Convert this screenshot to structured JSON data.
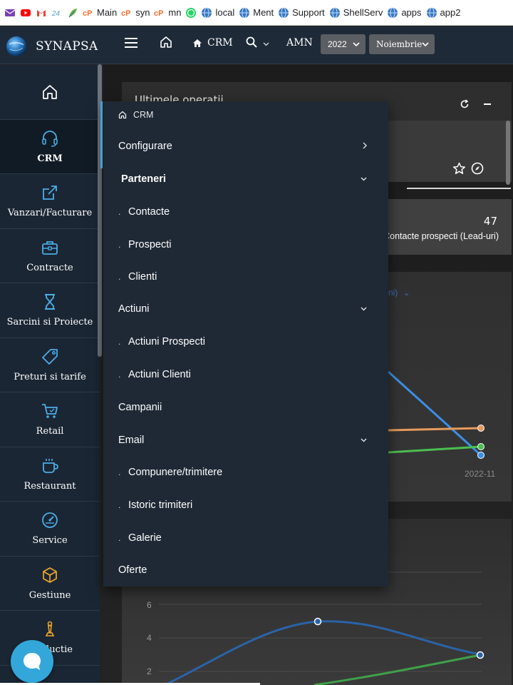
{
  "bookmarks": [
    {
      "label": "",
      "icon": "envelope-icon",
      "color": "#7b3fb3"
    },
    {
      "label": "",
      "icon": "youtube-icon",
      "color": "#ff0000"
    },
    {
      "label": "",
      "icon": "gmail-icon",
      "color": "#ea4335"
    },
    {
      "label": "",
      "icon": "24-icon",
      "color": "#5aa0e0"
    },
    {
      "label": "",
      "icon": "leaf-icon",
      "color": "#7bb84a"
    },
    {
      "label": "Main",
      "icon": "cpanel-icon",
      "color": "#ff6c2c"
    },
    {
      "label": "syn",
      "icon": "cpanel-icon",
      "color": "#ff6c2c"
    },
    {
      "label": "mn",
      "icon": "cpanel-icon",
      "color": "#ff6c2c"
    },
    {
      "label": "",
      "icon": "whatsapp-icon",
      "color": "#25d366"
    },
    {
      "label": "local",
      "icon": "globe-icon",
      "color": "#3b78c2"
    },
    {
      "label": "Ment",
      "icon": "globe-icon",
      "color": "#3b78c2"
    },
    {
      "label": "Support",
      "icon": "globe-icon",
      "color": "#3b78c2"
    },
    {
      "label": "ShellServ",
      "icon": "globe-icon",
      "color": "#3b78c2"
    },
    {
      "label": "apps",
      "icon": "globe-icon",
      "color": "#3b78c2"
    },
    {
      "label": "app2",
      "icon": "globe-icon",
      "color": "#3b78c2"
    }
  ],
  "topbar": {
    "brand": "SYNAPSA",
    "crm_label": "CRM",
    "user_label": "AMN",
    "year_value": "2022",
    "month_value": "Noiembrie"
  },
  "sidebar": {
    "items": [
      {
        "label": "",
        "icon": "home-icon",
        "active": false
      },
      {
        "label": "CRM",
        "icon": "headset-icon",
        "active": true
      },
      {
        "label": "Vanzari/Facturare",
        "icon": "share-icon",
        "active": false
      },
      {
        "label": "Contracte",
        "icon": "briefcase-icon",
        "active": false
      },
      {
        "label": "Sarcini si Proiecte",
        "icon": "hourglass-icon",
        "active": false
      },
      {
        "label": "Preturi si tarife",
        "icon": "tag-icon",
        "active": false
      },
      {
        "label": "Retail",
        "icon": "cart-icon",
        "active": false
      },
      {
        "label": "Restaurant",
        "icon": "coffee-icon",
        "active": false
      },
      {
        "label": "Service",
        "icon": "gauge-icon",
        "active": false
      },
      {
        "label": "Gestiune",
        "icon": "boxes-icon",
        "active": false
      },
      {
        "label": "Productie",
        "icon": "chess-icon",
        "active": false
      }
    ]
  },
  "dashboard": {
    "card1_title": "Ultimele operatii",
    "card2_value": "47",
    "card2_label": "Contacte prospecti (Lead-uri)",
    "card3_filter": "ni)",
    "card3_tick": "2022-11",
    "card4_yticks": [
      "6",
      "4",
      "2"
    ]
  },
  "menu": {
    "header": "CRM",
    "items": [
      {
        "label": "Configurare",
        "level": "top",
        "arrow": "chevron-right-icon"
      },
      {
        "label": "Parteneri",
        "level": "bold",
        "arrow": "chevron-down-icon"
      },
      {
        "label": "Contacte",
        "level": "sub",
        "dot": "."
      },
      {
        "label": "Prospecti",
        "level": "sub",
        "dot": "."
      },
      {
        "label": "Clienti",
        "level": "sub",
        "dot": "."
      },
      {
        "label": "Actiuni",
        "level": "top",
        "arrow": "chevron-down-icon"
      },
      {
        "label": "Actiuni Prospecti",
        "level": "sub",
        "dot": "."
      },
      {
        "label": "Actiuni Clienti",
        "level": "sub",
        "dot": "."
      },
      {
        "label": "Campanii",
        "level": "top"
      },
      {
        "label": "Email",
        "level": "top",
        "arrow": "chevron-down-icon"
      },
      {
        "label": "Compunere/trimitere",
        "level": "sub",
        "dot": "."
      },
      {
        "label": "Istoric trimiteri",
        "level": "sub",
        "dot": "."
      },
      {
        "label": "Galerie",
        "level": "sub",
        "dot": "."
      },
      {
        "label": "Oferte",
        "level": "top"
      }
    ]
  },
  "colors": {
    "accent": "#4a9fd8",
    "sidebar_bg": "#1b2634",
    "menu_bg": "#1f2935",
    "chat_bubble": "#33a7d9"
  }
}
